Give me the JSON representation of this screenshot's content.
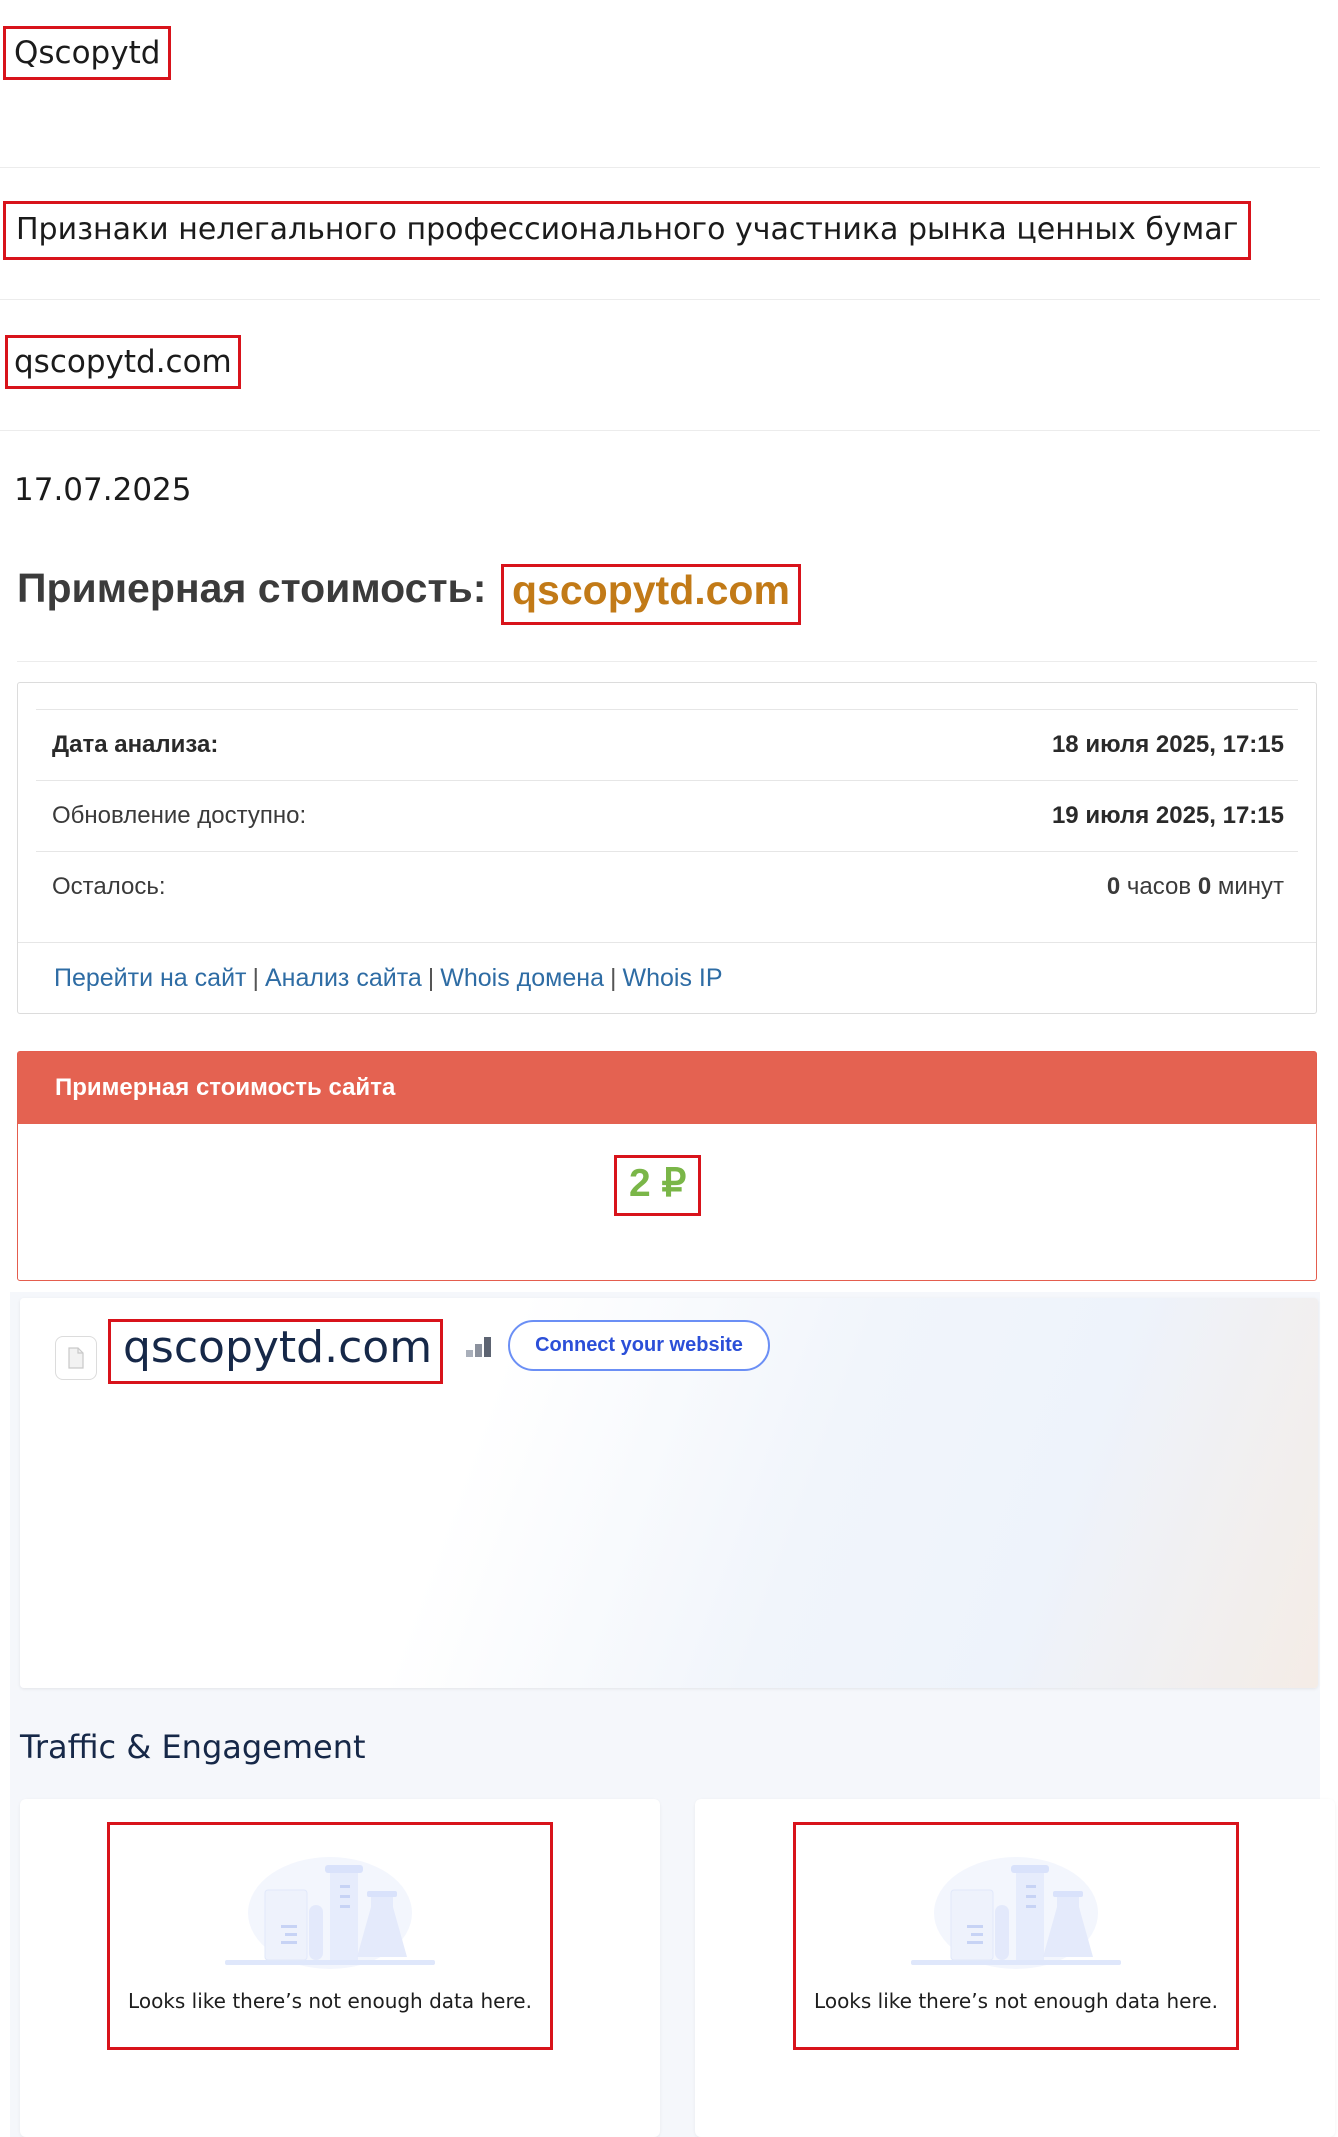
{
  "header": {
    "title": "Qscopytd",
    "warning": "Признаки нелегального профессионального участника рынка ценных бумаг",
    "domain": "qscopytd.com",
    "date": "17.07.2025"
  },
  "estimate": {
    "heading": "Примерная стоимость:",
    "domain": "qscopytd.com"
  },
  "analysis": {
    "rows": [
      {
        "label": "Дата анализа:",
        "value": "18 июля 2025, 17:15"
      },
      {
        "label": "Обновление доступно:",
        "value": "19 июля 2025, 17:15"
      },
      {
        "label": "Осталось:",
        "value_hours": "0",
        "hours_unit": "часов",
        "value_minutes": "0",
        "minutes_unit": "минут"
      }
    ],
    "links": [
      "Перейти на сайт",
      "Анализ сайта",
      "Whois домена",
      "Whois IP"
    ],
    "separator": "|"
  },
  "site_cost": {
    "title": "Примерная стоимость сайта",
    "value": "2 ₽"
  },
  "similarweb": {
    "domain": "qscopytd.com",
    "connect_label": "Connect your website",
    "section_title": "Traffic & Engagement",
    "empty_messages": [
      "Looks like there’s not enough data here.",
      "Looks like there’s not enough data here."
    ]
  },
  "colors": {
    "highlight": "#d8131b",
    "estimate_domain": "#c27a17",
    "cost_header": "#e46251",
    "cost_value": "#7ab648",
    "link": "#2e6ca4",
    "connect": "#2b4fd8"
  }
}
